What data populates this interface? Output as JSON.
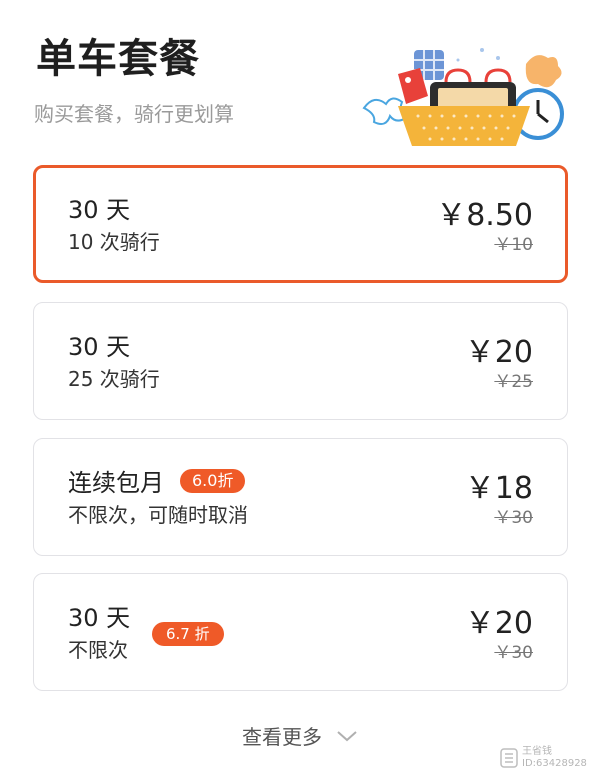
{
  "header": {
    "title": "单车套餐",
    "subtitle": "购买套餐，骑行更划算"
  },
  "plans": [
    {
      "line1": "30 天",
      "line2": "10 次骑行",
      "price": "￥8.50",
      "original": "￥10",
      "badge": "",
      "selected": true
    },
    {
      "line1": "30 天",
      "line2": "25 次骑行",
      "price": "￥20",
      "original": "￥25",
      "badge": "",
      "selected": false
    },
    {
      "line1": "连续包月",
      "line2": "不限次，可随时取消",
      "price": "￥18",
      "original": "￥30",
      "badge": "6.0折",
      "selected": false
    },
    {
      "line1": "30 天",
      "line2": "不限次",
      "price": "￥20",
      "original": "￥30",
      "badge": "6.7 折",
      "selected": false
    }
  ],
  "footer": {
    "more_label": "查看更多"
  },
  "watermark": {
    "name": "王省钱",
    "id": "ID:63428928"
  },
  "colors": {
    "accent": "#ea5a2a",
    "badge": "#ef5a28",
    "card_border": "#e2e2e6"
  }
}
